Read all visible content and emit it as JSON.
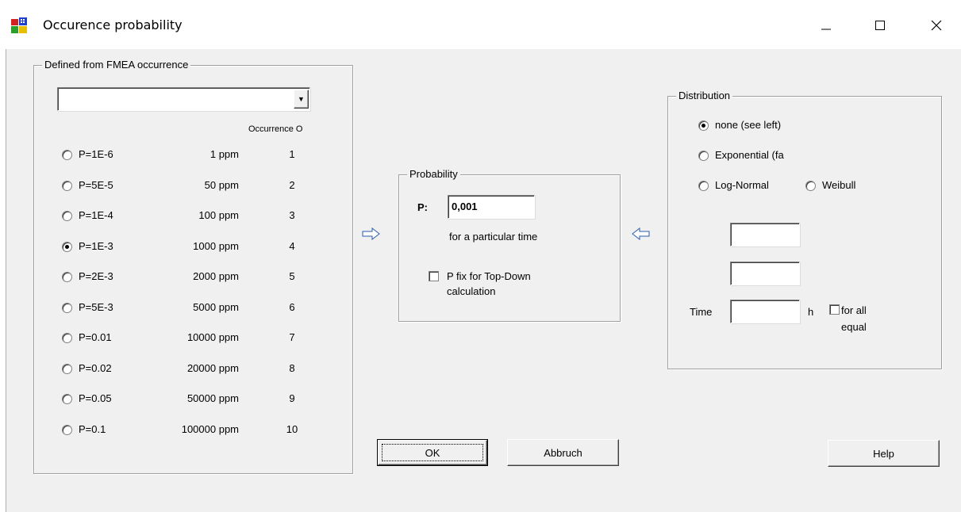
{
  "window": {
    "title": "Occurence probability",
    "min_glyph": "—",
    "max_glyph": "☐",
    "close_glyph": "✕"
  },
  "fmea": {
    "legend": "Defined from FMEA occurrence",
    "dropdown_value": "",
    "dropdown_arrow": "▼",
    "occ_header": "Occurrence O",
    "rows": [
      {
        "p": "P=1E-6",
        "ppm": "1 ppm",
        "occ": "1",
        "selected": false
      },
      {
        "p": "P=5E-5",
        "ppm": "50 ppm",
        "occ": "2",
        "selected": false
      },
      {
        "p": "P=1E-4",
        "ppm": "100 ppm",
        "occ": "3",
        "selected": false
      },
      {
        "p": "P=1E-3",
        "ppm": "1000 ppm",
        "occ": "4",
        "selected": true
      },
      {
        "p": "P=2E-3",
        "ppm": "2000 ppm",
        "occ": "5",
        "selected": false
      },
      {
        "p": "P=5E-3",
        "ppm": "5000 ppm",
        "occ": "6",
        "selected": false
      },
      {
        "p": "P=0.01",
        "ppm": "10000 ppm",
        "occ": "7",
        "selected": false
      },
      {
        "p": "P=0.02",
        "ppm": "20000 ppm",
        "occ": "8",
        "selected": false
      },
      {
        "p": "P=0.05",
        "ppm": "50000 ppm",
        "occ": "9",
        "selected": false
      },
      {
        "p": "P=0.1",
        "ppm": "100000 ppm",
        "occ": "10",
        "selected": false
      }
    ]
  },
  "probability": {
    "legend": "Probability",
    "p_label": "P:",
    "p_value": "0,001",
    "time_note": "for a particular time",
    "fix_line1": "P fix for Top-Down",
    "fix_line2": "calculation",
    "fix_checked": false
  },
  "distribution": {
    "legend": "Distribution",
    "none_label": "none (see left)",
    "exp_label": "Exponential (fa",
    "lognormal_label": "Log-Normal",
    "weibull_label": "Weibull",
    "selected": "none",
    "param1": "",
    "param2": "",
    "time_label": "Time",
    "time_value": "",
    "time_unit": "h",
    "forall_line1": "for all",
    "forall_line2": "equal",
    "forall_checked": false
  },
  "buttons": {
    "ok": "OK",
    "cancel": "Abbruch",
    "help": "Help"
  }
}
